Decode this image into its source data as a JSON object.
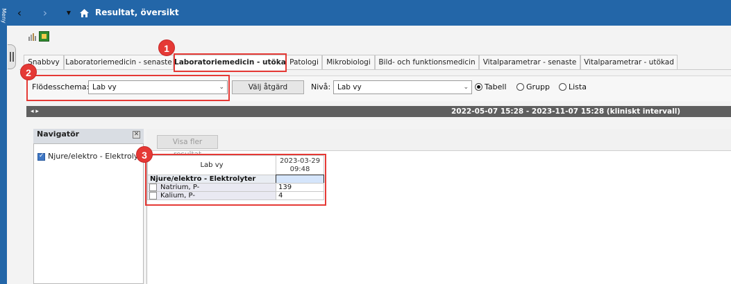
{
  "sidebar": {
    "menu_label": "Meny"
  },
  "titlebar": {
    "title": "Resultat, översikt",
    "back_icon": "‹",
    "forward_icon": "›",
    "dropdown_icon": "▼",
    "home_icon": "home-icon"
  },
  "tabs": [
    {
      "label": "Snabbvy"
    },
    {
      "label": "Laboratoriemedicin - senaste"
    },
    {
      "label": "Laboratoriemedicin - utökad",
      "active": true
    },
    {
      "label": "Patologi"
    },
    {
      "label": "Mikrobiologi"
    },
    {
      "label": "Bild- och funktionsmedicin"
    },
    {
      "label": "Vitalparametrar - senaste"
    },
    {
      "label": "Vitalparametrar - utökad"
    }
  ],
  "filter": {
    "flodesschema_label": "Flödesschema:",
    "flodesschema_value": "Lab vy",
    "valj_atgard_label": "Välj åtgärd",
    "niva_label": "Nivå:",
    "niva_value": "Lab vy",
    "view_options": [
      {
        "label": "Tabell",
        "selected": true
      },
      {
        "label": "Grupp",
        "selected": false
      },
      {
        "label": "Lista",
        "selected": false
      }
    ]
  },
  "datebar": {
    "nav": "◂ ▸",
    "interval": "2022-05-07 15:28 - 2023-11-07 15:28 (kliniskt intervall)"
  },
  "navigator": {
    "title": "Navigatör",
    "close": "✕",
    "items": [
      {
        "label": "Njure/elektro - Elektrolyter",
        "checked": true
      }
    ]
  },
  "results": {
    "visa_fler_label": "Visa fler resultat",
    "table": {
      "header_name": "Lab vy",
      "header_date": "2023-03-29",
      "header_time": "09:48",
      "group": "Njure/elektro - Elektrolyter",
      "rows": [
        {
          "name": "Natrium, P-",
          "value": "139"
        },
        {
          "name": "Kalium, P-",
          "value": "4"
        }
      ]
    }
  },
  "callouts": [
    "1",
    "2",
    "3"
  ],
  "colors": {
    "titlebar": "#2366a8",
    "callout": "#e53935",
    "datebar": "#5f5f5f"
  }
}
